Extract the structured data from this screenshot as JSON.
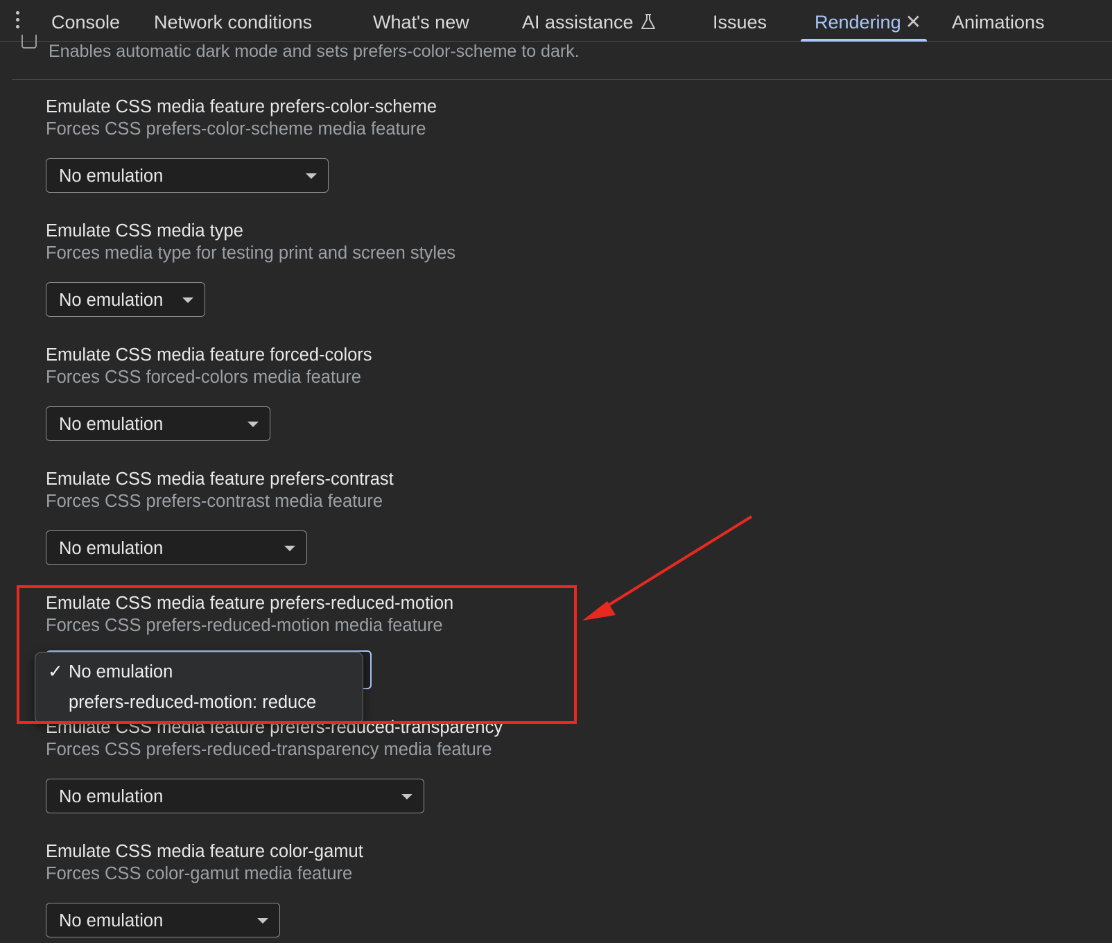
{
  "tabs": [
    {
      "label": "Console"
    },
    {
      "label": "Network conditions"
    },
    {
      "label": "What's new"
    },
    {
      "label": "AI assistance"
    },
    {
      "label": "Issues"
    },
    {
      "label": "Rendering",
      "active": true
    },
    {
      "label": "Animations"
    }
  ],
  "top": {
    "description": "Enables automatic dark mode and sets prefers-color-scheme to dark."
  },
  "sections": [
    {
      "title": "Emulate CSS media feature prefers-color-scheme",
      "description": "Forces CSS prefers-color-scheme media feature",
      "value": "No emulation"
    },
    {
      "title": "Emulate CSS media type",
      "description": "Forces media type for testing print and screen styles",
      "value": "No emulation"
    },
    {
      "title": "Emulate CSS media feature forced-colors",
      "description": "Forces CSS forced-colors media feature",
      "value": "No emulation"
    },
    {
      "title": "Emulate CSS media feature prefers-contrast",
      "description": "Forces CSS prefers-contrast media feature",
      "value": "No emulation"
    },
    {
      "title": "Emulate CSS media feature prefers-reduced-motion",
      "description": "Forces CSS prefers-reduced-motion media feature"
    },
    {
      "title": "Emulate CSS media feature prefers-reduced-transparency",
      "description": "Forces CSS prefers-reduced-transparency media feature",
      "value": "No emulation"
    },
    {
      "title": "Emulate CSS media feature color-gamut",
      "description": "Forces CSS color-gamut media feature",
      "value": "No emulation"
    }
  ],
  "dropdown": {
    "check": "✓",
    "options": [
      {
        "label": "No emulation",
        "selected": true
      },
      {
        "label": "prefers-reduced-motion: reduce",
        "selected": false
      }
    ]
  },
  "colors": {
    "accent": "#a8c7fa",
    "annotation": "#e8291f",
    "background": "#282828"
  }
}
